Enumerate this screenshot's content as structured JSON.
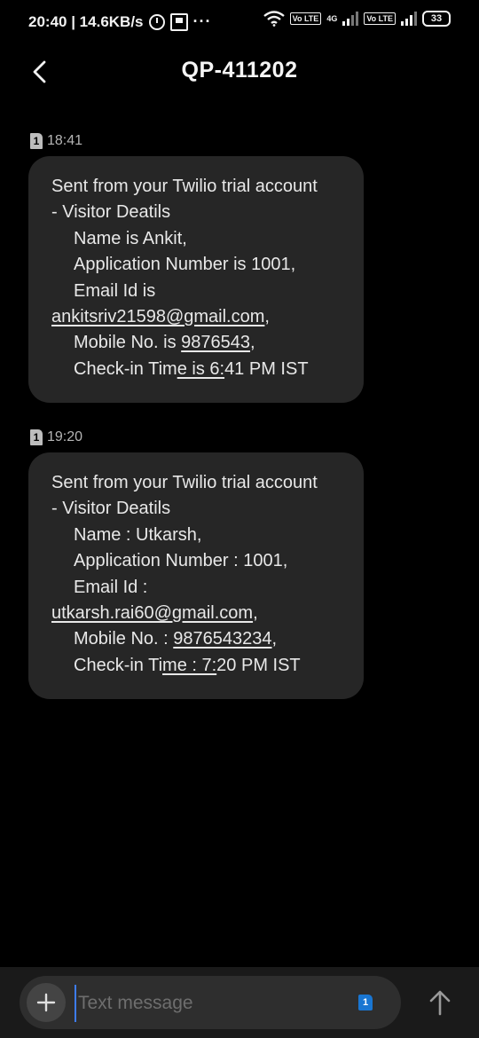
{
  "status_bar": {
    "time_speed": "20:40 | 14.6KB/s",
    "more": "···",
    "volte_1": "Vo LTE",
    "network_type": "4G",
    "volte_2": "Vo LTE",
    "battery": "33"
  },
  "header": {
    "title": "QP-411202"
  },
  "messages": [
    {
      "sim": "1",
      "time": "18:41",
      "lines": {
        "l1": "Sent from your Twilio trial account",
        "l2": "- Visitor Deatils",
        "l3": "Name is Ankit,",
        "l4": "Application Number is 1001,",
        "l5": "Email Id is",
        "l6_link": "ankitsriv21598@gmail.com",
        "l6_tail": ",",
        "l7_pre": "Mobile No. is ",
        "l7_link": "9876543",
        "l7_tail": ",",
        "l8_pre": "Check-in Tim",
        "l8_link": "e is 6:",
        "l8_tail": "41 PM IST"
      }
    },
    {
      "sim": "1",
      "time": "19:20",
      "lines": {
        "l1": "Sent from your Twilio trial account",
        "l2": "- Visitor Deatils",
        "l3": "Name : Utkarsh,",
        "l4": "Application Number : 1001,",
        "l5": "Email Id :",
        "l6_link": "utkarsh.rai60@gmail.com",
        "l6_tail": ",",
        "l7_pre": "Mobile No. : ",
        "l7_link": "9876543234",
        "l7_tail": ",",
        "l8_pre": "Check-in Ti",
        "l8_link": "me : 7:",
        "l8_tail": "20 PM IST"
      }
    }
  ],
  "composer": {
    "placeholder": "Text message",
    "sim": "1"
  },
  "icons": {
    "back": "back-arrow-icon",
    "plus": "plus-icon",
    "send": "send-arrow-icon"
  },
  "colors": {
    "background": "#000000",
    "bubble": "#262626",
    "accent": "#1976d2"
  }
}
